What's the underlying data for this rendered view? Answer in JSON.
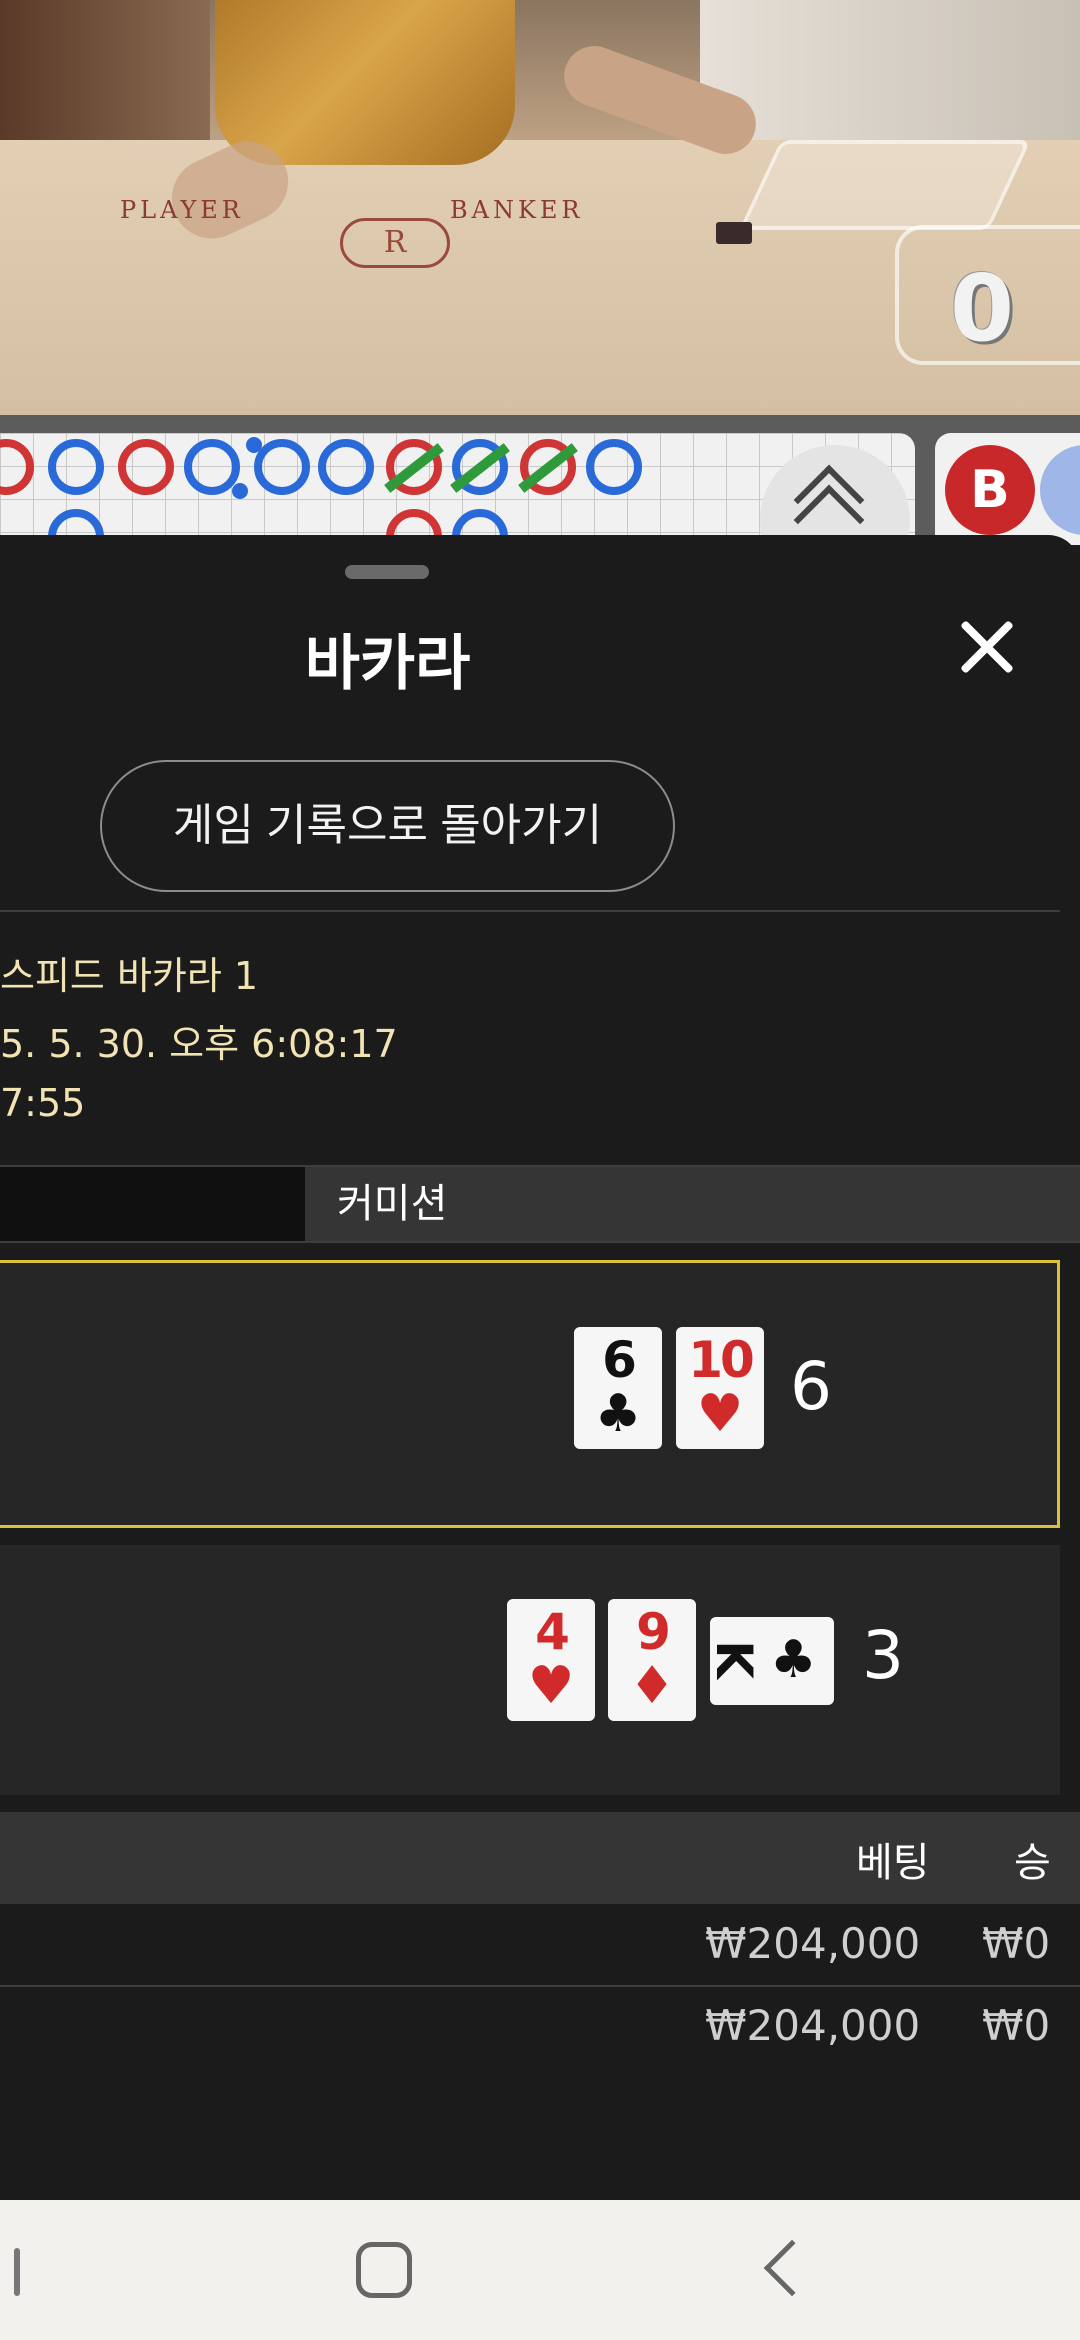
{
  "video": {
    "table_labels": {
      "player": "PLAYER",
      "banker": "BANKER"
    },
    "logo_letter": "R",
    "counter": "0"
  },
  "roadmap": {
    "banker_chip": "B",
    "scroll_icon": "double-chevron-up-icon"
  },
  "sheet": {
    "title": "바카라",
    "close_icon": "close-icon",
    "back_button": "게임 기록으로 돌아가기",
    "info": {
      "table_name": "스피드 바카라 1",
      "datetime": "5. 5. 30. 오후 6:08:17",
      "duration": "7:55"
    },
    "tabs": [
      "",
      "커미션"
    ],
    "player_hand": {
      "cards": [
        {
          "rank": "6",
          "suit": "♣",
          "color": "black"
        },
        {
          "rank": "10",
          "suit": "♥",
          "color": "red"
        }
      ],
      "total": "6"
    },
    "banker_hand": {
      "cards": [
        {
          "rank": "4",
          "suit": "♥",
          "color": "red"
        },
        {
          "rank": "9",
          "suit": "♦",
          "color": "red"
        },
        {
          "rank": "K",
          "suit": "♣",
          "color": "black"
        }
      ],
      "total": "3"
    },
    "bets": {
      "headers": {
        "bet": "베팅",
        "win": "승"
      },
      "rows": [
        {
          "amount": "₩204,000",
          "win": "₩0"
        },
        {
          "amount": "₩204,000",
          "win": "₩0"
        }
      ]
    }
  },
  "colors": {
    "accent_gold": "#d9c23a",
    "info_text": "#f1e3b3",
    "banker_red": "#c8282a",
    "player_blue": "#2a6ad8"
  },
  "navbar": {
    "recent_icon": "recent-apps-icon",
    "home_icon": "home-icon",
    "back_icon": "back-icon"
  }
}
